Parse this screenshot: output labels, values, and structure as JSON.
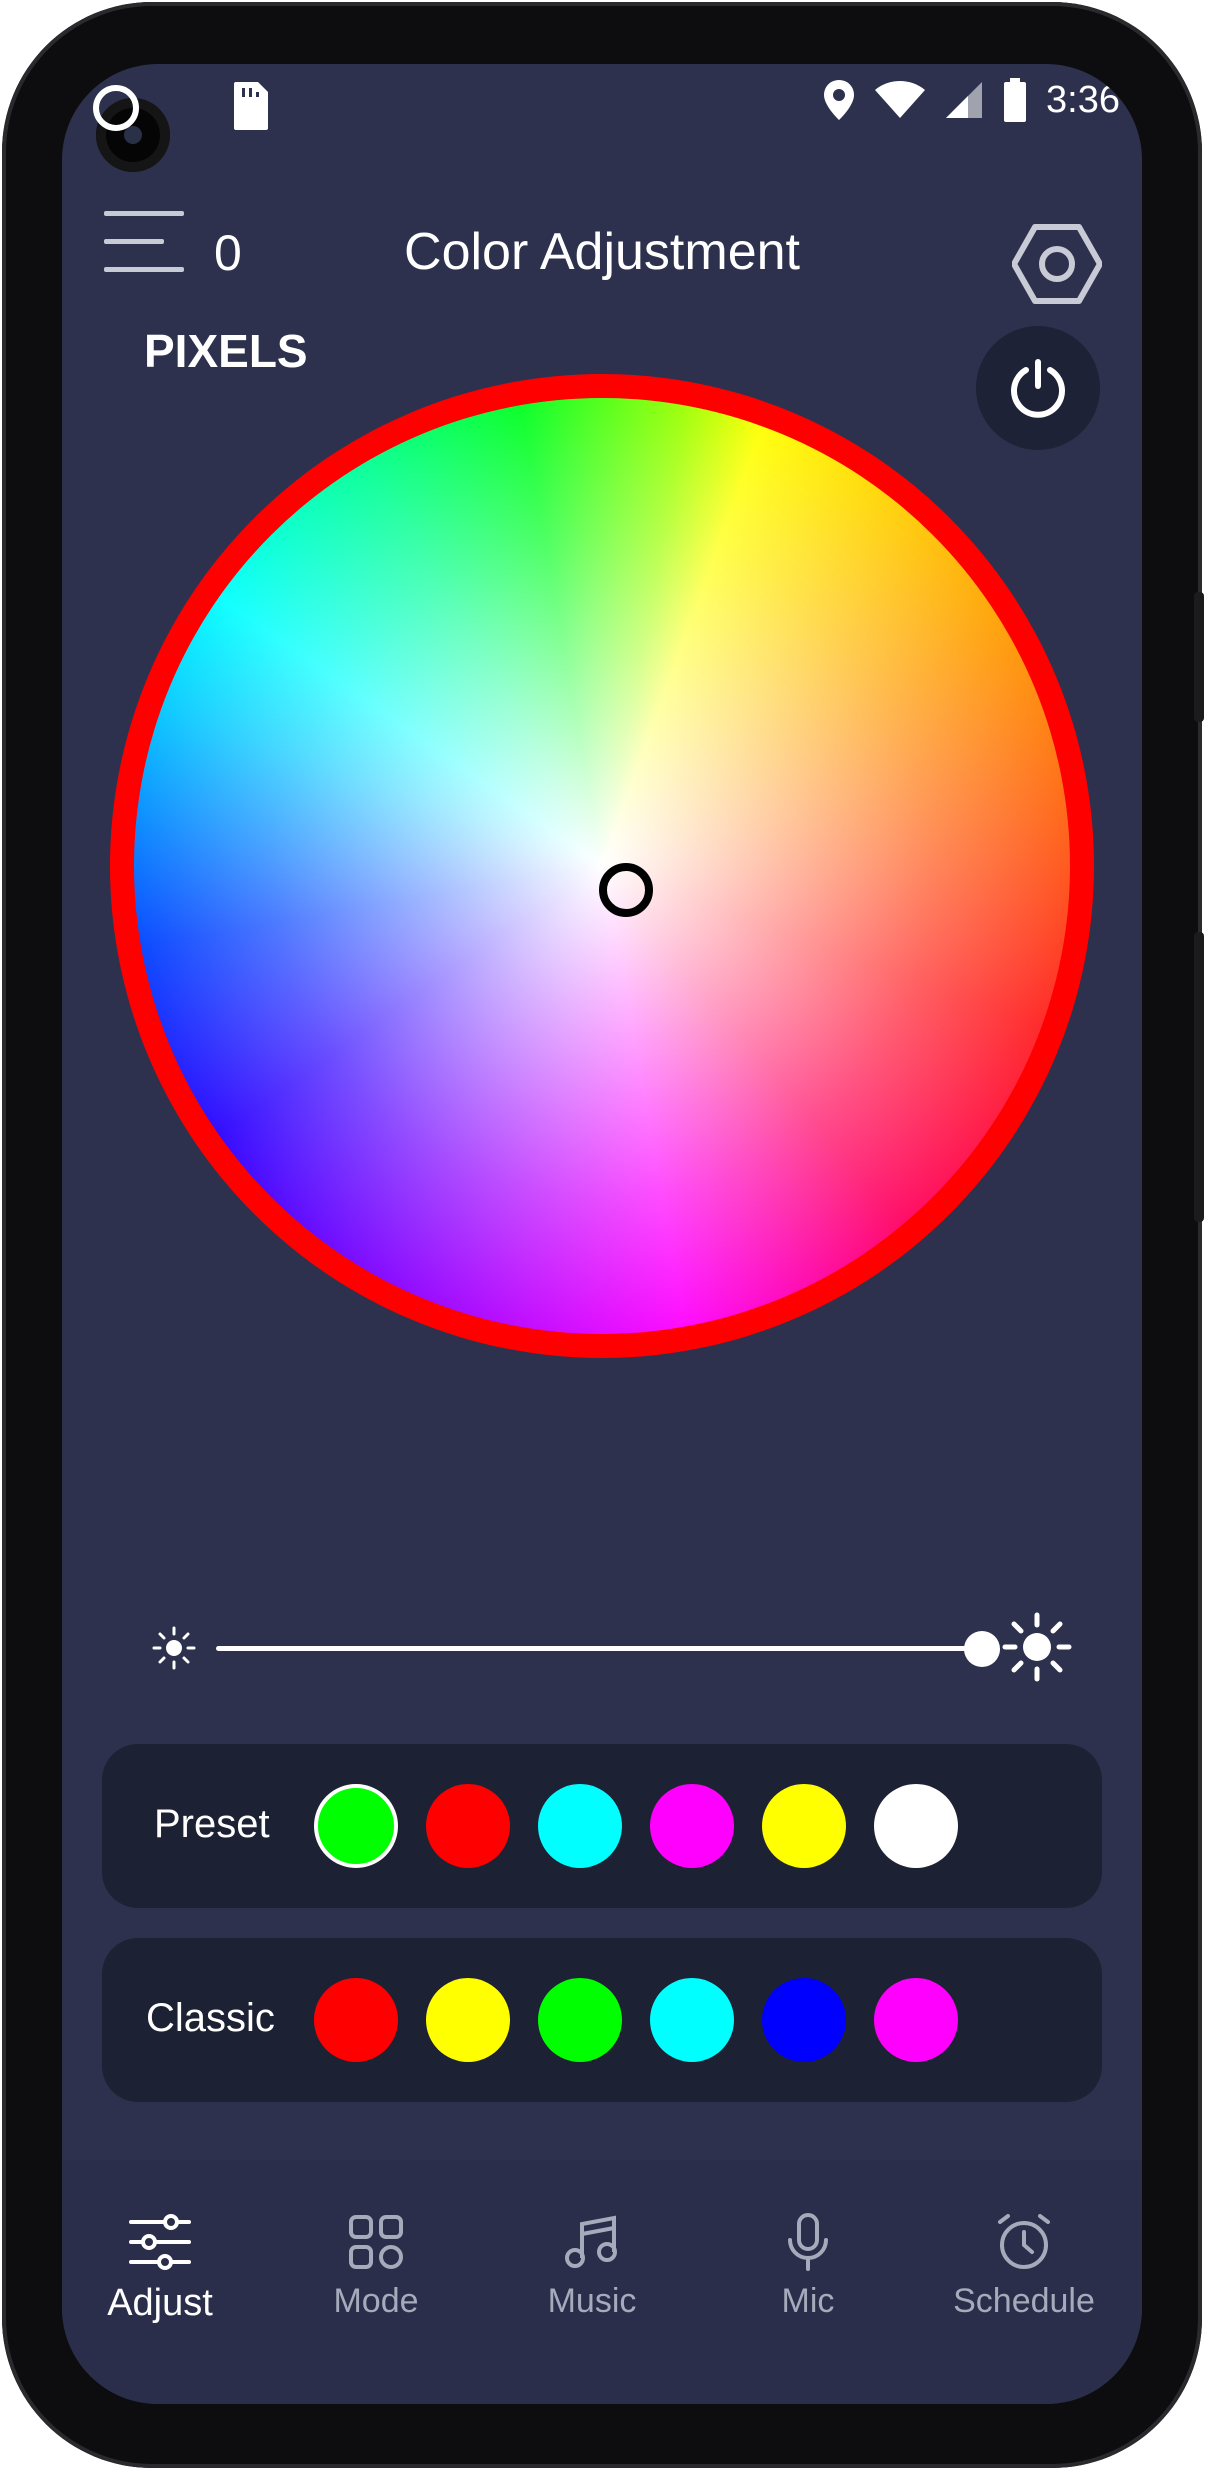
{
  "status_bar": {
    "time": "3:36",
    "icons": [
      "camera-cutout",
      "sim-icon",
      "location-icon",
      "wifi-icon",
      "signal-icon",
      "battery-icon"
    ]
  },
  "header": {
    "title": "Color Adjustment",
    "device_count": "0",
    "menu_icon": "menu-icon",
    "settings_icon": "settings-hex-icon"
  },
  "device": {
    "name": "PIXELS",
    "power_icon": "power-icon",
    "ring_color": "#ff0000"
  },
  "color_wheel": {
    "selected": "center-white"
  },
  "brightness": {
    "value_percent": 100
  },
  "preset": {
    "label": "Preset",
    "colors": [
      "#00ff00",
      "#ff0000",
      "#00ffff",
      "#ff00ff",
      "#ffff00",
      "#ffffff"
    ],
    "selected_index": 0
  },
  "classic": {
    "label": "Classic",
    "colors": [
      "#ff0000",
      "#ffff00",
      "#00ff00",
      "#00ffff",
      "#0000ff",
      "#ff00ff"
    ]
  },
  "nav": {
    "items": [
      {
        "label": "Adjust",
        "icon": "sliders-icon",
        "active": true
      },
      {
        "label": "Mode",
        "icon": "grid-icon",
        "active": false
      },
      {
        "label": "Music",
        "icon": "music-icon",
        "active": false
      },
      {
        "label": "Mic",
        "icon": "mic-icon",
        "active": false
      },
      {
        "label": "Schedule",
        "icon": "alarm-icon",
        "active": false
      }
    ]
  },
  "theme": {
    "background": "#2d314d",
    "panel": "#1d2134",
    "text": "#ffffff",
    "nav_inactive": "#a7aabb"
  }
}
